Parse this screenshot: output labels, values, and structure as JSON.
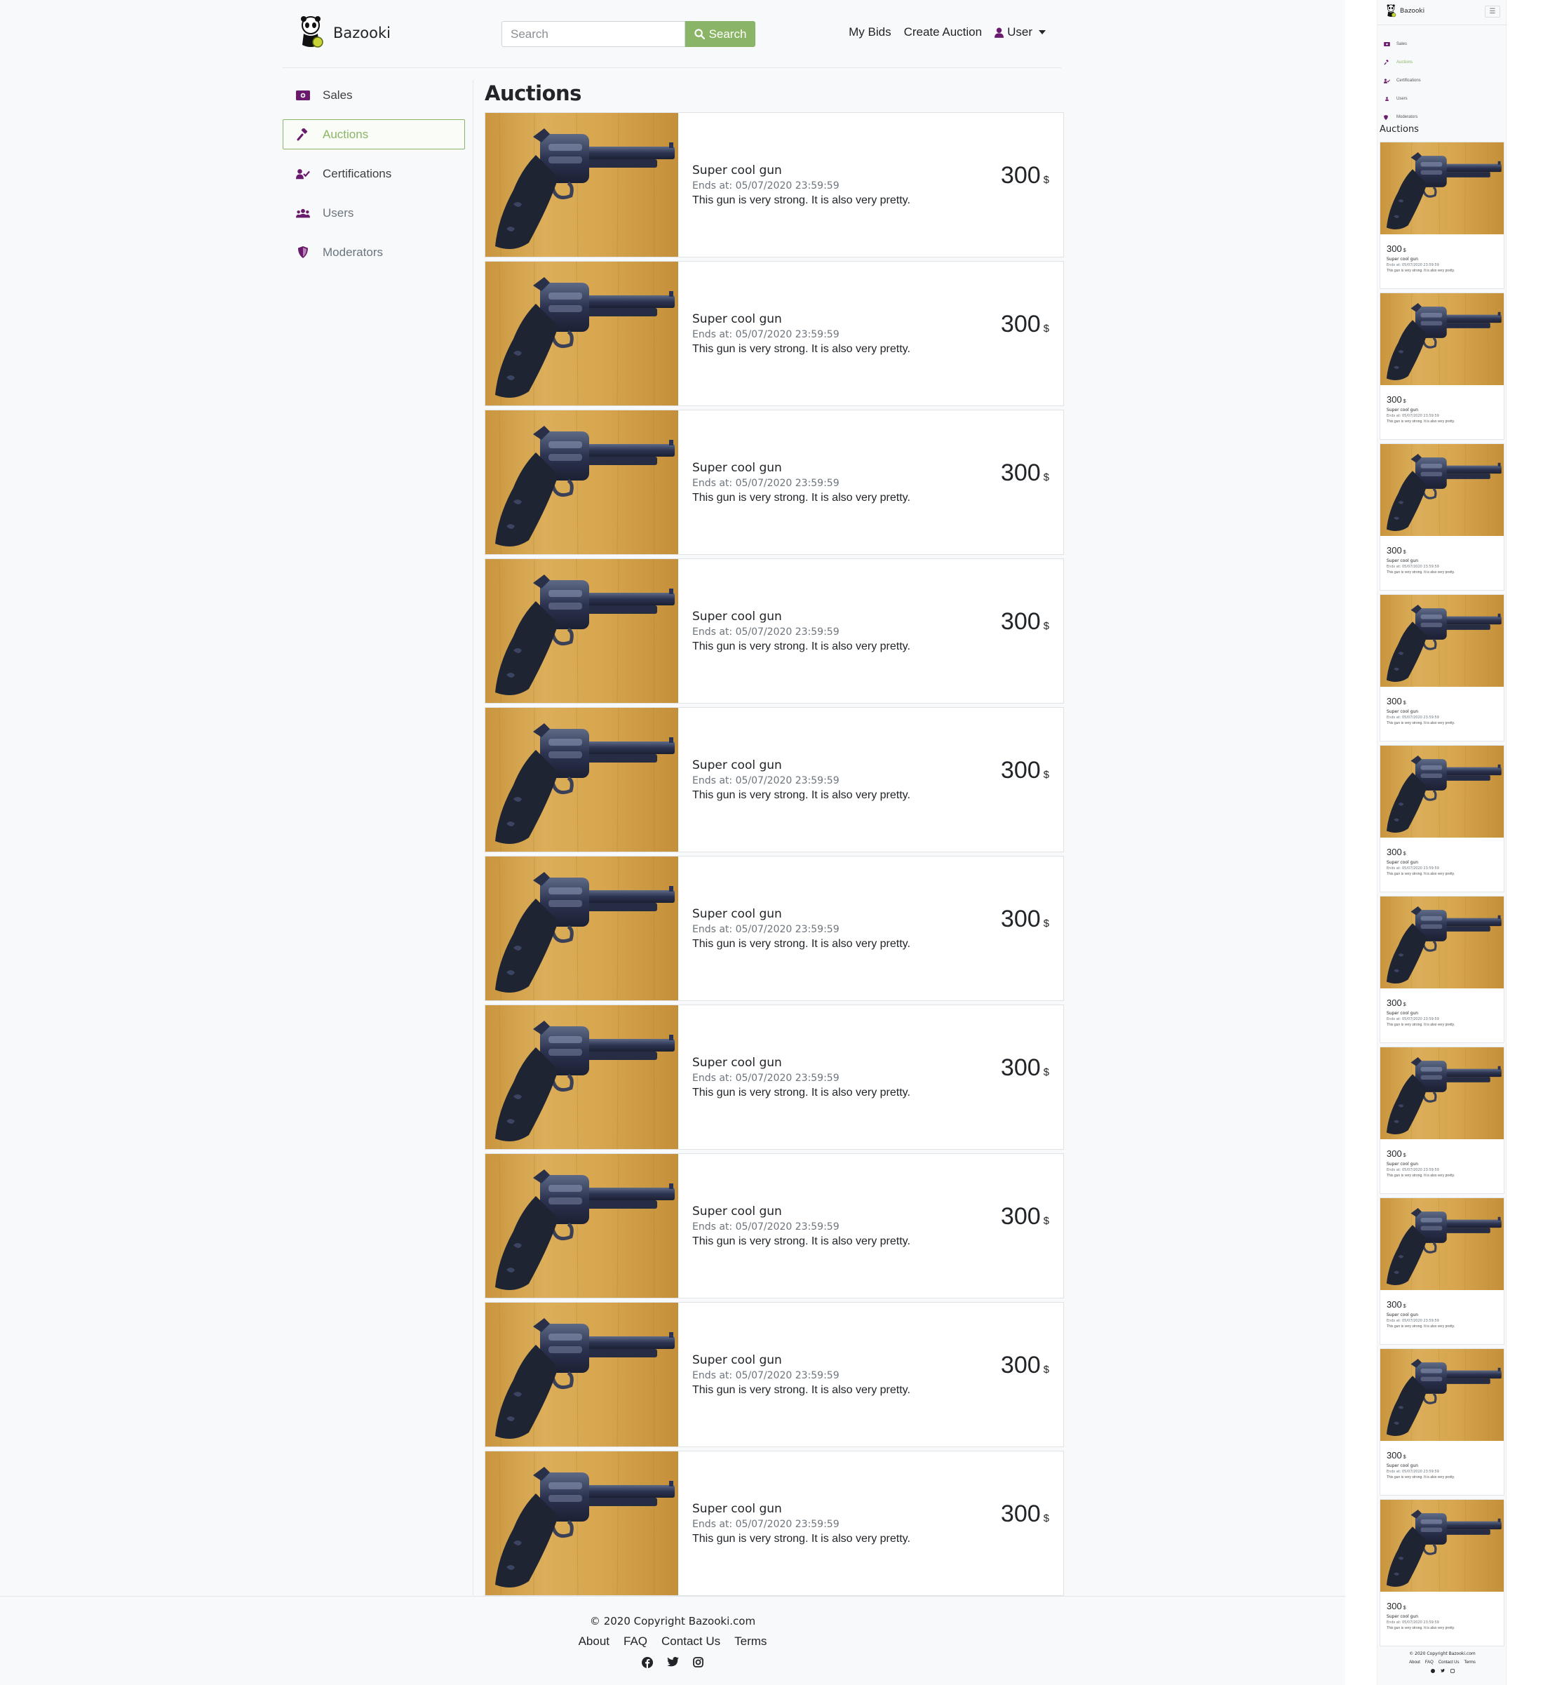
{
  "brand": {
    "name": "Bazooki"
  },
  "search": {
    "placeholder": "Search",
    "button_label": "Search"
  },
  "nav": {
    "my_bids": "My Bids",
    "create_auction": "Create Auction",
    "user": "User"
  },
  "sidebar": {
    "items": [
      {
        "label": "Sales",
        "icon": "money-bill-icon",
        "active": false
      },
      {
        "label": "Auctions",
        "icon": "gavel-icon",
        "active": true
      },
      {
        "label": "Certifications",
        "icon": "user-check-icon",
        "active": false
      },
      {
        "label": "Users",
        "icon": "users-icon",
        "active": false
      },
      {
        "label": "Moderators",
        "icon": "shield-icon",
        "active": false
      }
    ]
  },
  "page": {
    "title": "Auctions"
  },
  "auctions": [
    {
      "title": "Super cool gun",
      "ends": "Ends at: 05/07/2020 23:59:59",
      "description": "This gun is very strong. It is also very pretty.",
      "price": "300",
      "currency": "$"
    },
    {
      "title": "Super cool gun",
      "ends": "Ends at: 05/07/2020 23:59:59",
      "description": "This gun is very strong. It is also very pretty.",
      "price": "300",
      "currency": "$"
    },
    {
      "title": "Super cool gun",
      "ends": "Ends at: 05/07/2020 23:59:59",
      "description": "This gun is very strong. It is also very pretty.",
      "price": "300",
      "currency": "$"
    },
    {
      "title": "Super cool gun",
      "ends": "Ends at: 05/07/2020 23:59:59",
      "description": "This gun is very strong. It is also very pretty.",
      "price": "300",
      "currency": "$"
    },
    {
      "title": "Super cool gun",
      "ends": "Ends at: 05/07/2020 23:59:59",
      "description": "This gun is very strong. It is also very pretty.",
      "price": "300",
      "currency": "$"
    },
    {
      "title": "Super cool gun",
      "ends": "Ends at: 05/07/2020 23:59:59",
      "description": "This gun is very strong. It is also very pretty.",
      "price": "300",
      "currency": "$"
    },
    {
      "title": "Super cool gun",
      "ends": "Ends at: 05/07/2020 23:59:59",
      "description": "This gun is very strong. It is also very pretty.",
      "price": "300",
      "currency": "$"
    },
    {
      "title": "Super cool gun",
      "ends": "Ends at: 05/07/2020 23:59:59",
      "description": "This gun is very strong. It is also very pretty.",
      "price": "300",
      "currency": "$"
    },
    {
      "title": "Super cool gun",
      "ends": "Ends at: 05/07/2020 23:59:59",
      "description": "This gun is very strong. It is also very pretty.",
      "price": "300",
      "currency": "$"
    },
    {
      "title": "Super cool gun",
      "ends": "Ends at: 05/07/2020 23:59:59",
      "description": "This gun is very strong. It is also very pretty.",
      "price": "300",
      "currency": "$"
    }
  ],
  "footer": {
    "copyright": "© 2020 Copyright Bazooki.com",
    "links": [
      "About",
      "FAQ",
      "Contact Us",
      "Terms"
    ],
    "social": [
      "facebook-icon",
      "twitter-icon",
      "instagram-icon"
    ]
  },
  "colors": {
    "accent": "#8bb566",
    "icon_purple": "#6a1b6e",
    "background": "#f8f9fa"
  },
  "mobile": {
    "menu_icon": "hamburger-icon"
  }
}
